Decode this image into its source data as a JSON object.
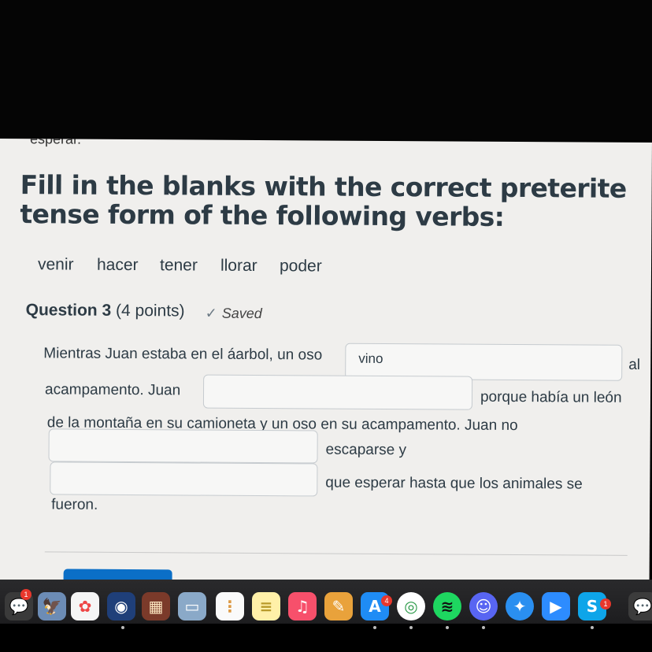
{
  "previous_text": "esperar.",
  "instructions": "Fill in the blanks with the correct preterite tense form of the following verbs:",
  "verbs": [
    "venir",
    "hacer",
    "tener",
    "llorar",
    "poder"
  ],
  "question": {
    "title": "Question 3",
    "points": "(4 points)",
    "saved_label": "Saved",
    "check_glyph": "✓",
    "segments": [
      "Mientras Juan estaba en el áarbol, un oso",
      "al",
      "acampamento. Juan",
      "porque había un león",
      "de la montaña en su camioneta y un oso en su acampamento.  Juan no",
      "escaparse y",
      "que esperar hasta que los animales se",
      "fueron."
    ],
    "blanks": [
      {
        "value": "vino"
      },
      {
        "value": ""
      },
      {
        "value": ""
      },
      {
        "value": ""
      }
    ]
  },
  "dock": {
    "badges": {
      "messages": "1",
      "appstore": "4",
      "skype": "1"
    }
  }
}
